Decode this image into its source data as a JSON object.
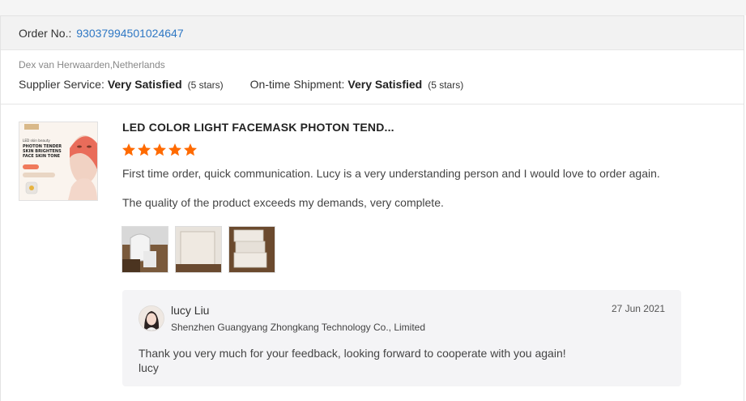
{
  "order": {
    "label": "Order No.:",
    "number": "93037994501024647"
  },
  "buyer": "Dex van Herwaarden,Netherlands",
  "ratings": {
    "supplier_label": "Supplier Service:",
    "supplier_value": "Very Satisfied",
    "supplier_stars": "(5 stars)",
    "shipment_label": "On-time Shipment:",
    "shipment_value": "Very Satisfied",
    "shipment_stars": "(5 stars)"
  },
  "product": {
    "title": "LED COLOR LIGHT FACEMASK PHOTON TEND...",
    "rating": 5,
    "rating_max": 5,
    "thumb_text": [
      "PHOTON TENDER",
      "SKIN BRIGHTENS",
      "FACE SKIN TONE"
    ]
  },
  "review": {
    "line1": "First time order, quick communication. Lucy is a very understanding person and I would love to order again.",
    "line2": "The quality of the product exceeds my demands, very complete.",
    "photo_icons": [
      "product-photo-icon",
      "box-photo-icon",
      "boxes-photo-icon"
    ]
  },
  "reply": {
    "name": "lucy Liu",
    "company": "Shenzhen Guangyang Zhongkang Technology Co., Limited",
    "date": "27 Jun 2021",
    "line1": "Thank you very much for your feedback, looking forward to cooperate with you again!",
    "line2": "lucy"
  },
  "colors": {
    "link": "#2f78c4",
    "star": "#ff6a00",
    "order_bar": "#f2f2f2",
    "reply_bg": "#f4f4f6"
  }
}
